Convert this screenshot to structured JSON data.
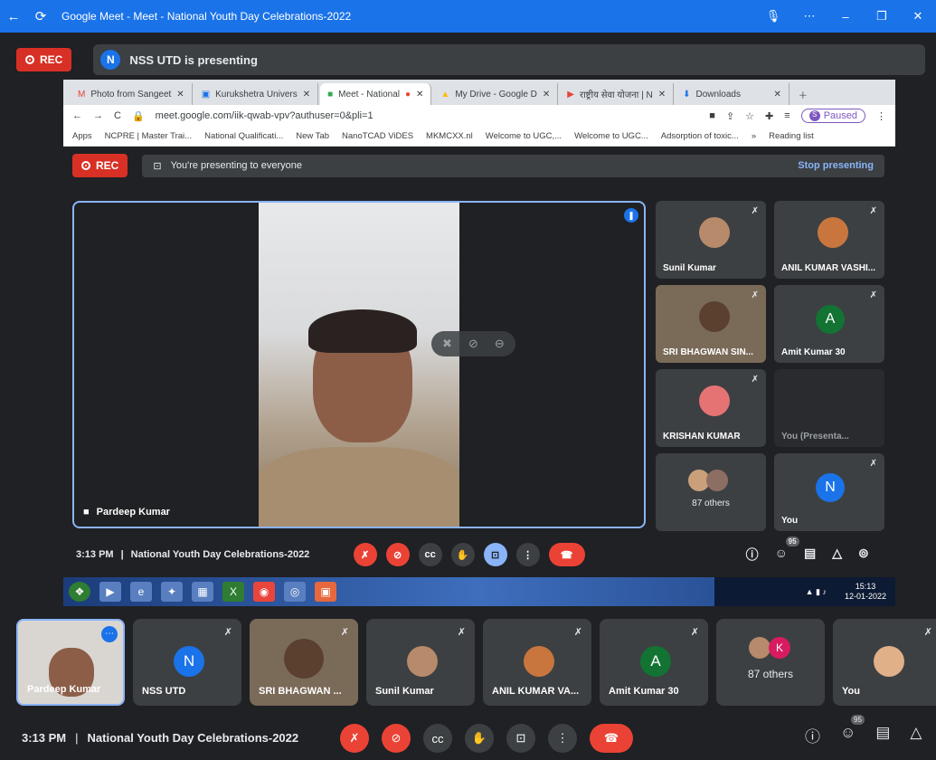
{
  "window": {
    "title": "Google Meet - Meet - National Youth Day Celebrations-2022"
  },
  "rec_label": "REC",
  "presenter": {
    "initial": "N",
    "text": "NSS UTD is presenting"
  },
  "browser": {
    "tabs": [
      "Photo from Sangeet",
      "Kurukshetra Univers",
      "Meet - National",
      "My Drive - Google D",
      "राष्ट्रीय सेवा योजना | N",
      "Downloads"
    ],
    "url": "meet.google.com/iik-qwab-vpv?authuser=0&pli=1",
    "profile": "Paused",
    "profile_initial": "S",
    "bookmarks": [
      "Apps",
      "NCPRE | Master Trai...",
      "National Qualificati...",
      "New Tab",
      "NanoTCAD ViDES",
      "MKMCXX.nl",
      "Welcome to UGC,...",
      "Welcome to UGC...",
      "Adsorption of toxic...",
      "»",
      "Reading list"
    ]
  },
  "inner": {
    "rec": "REC",
    "presenting_msg": "You're presenting to everyone",
    "stop": "Stop presenting",
    "main_name": "Pardeep Kumar",
    "tiles": [
      {
        "name": "Sunil Kumar"
      },
      {
        "name": "ANIL KUMAR VASHI..."
      },
      {
        "name": "SRI BHAGWAN SIN..."
      },
      {
        "name": "Amit Kumar 30",
        "initial": "A"
      },
      {
        "name": "KRISHAN KUMAR"
      },
      {
        "name": "You (Presenta..."
      },
      {
        "name": "87 others"
      },
      {
        "name": "You",
        "initial": "N"
      }
    ],
    "time": "3:13 PM",
    "meeting": "National Youth Day Celebrations-2022",
    "people_count": "95"
  },
  "taskbar": {
    "time": "15:13",
    "date": "12-01-2022"
  },
  "filmstrip": [
    {
      "name": "Pardeep Kumar"
    },
    {
      "name": "NSS UTD",
      "initial": "N"
    },
    {
      "name": "SRI BHAGWAN ..."
    },
    {
      "name": "Sunil Kumar"
    },
    {
      "name": "ANIL KUMAR VA..."
    },
    {
      "name": "Amit Kumar 30",
      "initial": "A"
    },
    {
      "name": "87 others",
      "initial": "K"
    },
    {
      "name": "You"
    }
  ],
  "bottom": {
    "time": "3:13 PM",
    "meeting": "National Youth Day Celebrations-2022",
    "people_count": "95"
  },
  "colors": {
    "accent": "#1a73e8",
    "danger": "#ea4335",
    "bg": "#202124",
    "tile": "#3c4043"
  }
}
